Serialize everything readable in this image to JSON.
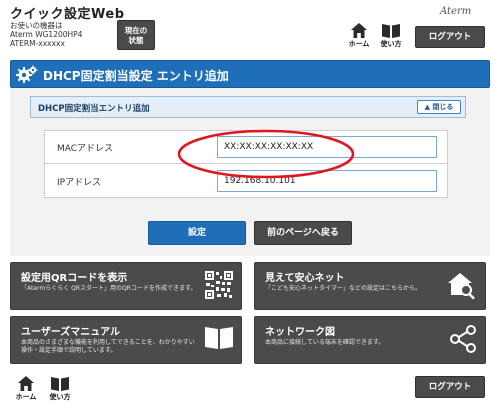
{
  "header": {
    "app_title": "クイック設定Web",
    "device_label": "お使いの機器は",
    "device_model": "Aterm WG1200HP4",
    "device_id": "ATERM-xxxxxx",
    "status_button_line1": "現在の",
    "status_button_line2": "状態",
    "home_label": "ホーム",
    "help_label": "使い方",
    "brand": "Aterm",
    "logout_label": "ログアウト"
  },
  "page": {
    "title": "DHCP固定割当設定 エントリ追加"
  },
  "section": {
    "title": "DHCP固定割当エントリ追加",
    "close_label": "閉じる"
  },
  "form": {
    "mac_label": "MACアドレス",
    "mac_value": "XX:XX:XX:XX:XX:XX",
    "ip_label": "IPアドレス",
    "ip_value": "192.168.10.101"
  },
  "buttons": {
    "submit": "設定",
    "back": "前のページへ戻る"
  },
  "tiles": [
    {
      "title": "設定用QRコードを表示",
      "desc": "「Atermらくらく QRスタート」用のQRコードを作成できます。",
      "icon": "qr-code-icon"
    },
    {
      "title": "見えて安心ネット",
      "desc": "「こども安心ネットタイマー」などの設定はこちらから。",
      "icon": "house-search-icon"
    },
    {
      "title": "ユーザーズマニュアル",
      "desc": "本商品のさまざまな機能を利用してできることを、わかりやすい操作・設定手順で説明しています。",
      "icon": "book-icon"
    },
    {
      "title": "ネットワーク図",
      "desc": "本商品に接続している端末を確認できます。",
      "icon": "network-icon"
    }
  ],
  "footer": {
    "home_label": "ホーム",
    "help_label": "使い方",
    "logout_label": "ログアウト"
  },
  "colors": {
    "accent_blue": "#1e6fb8",
    "dark_button": "#4a4a4a",
    "highlight_red": "#e0161e"
  }
}
